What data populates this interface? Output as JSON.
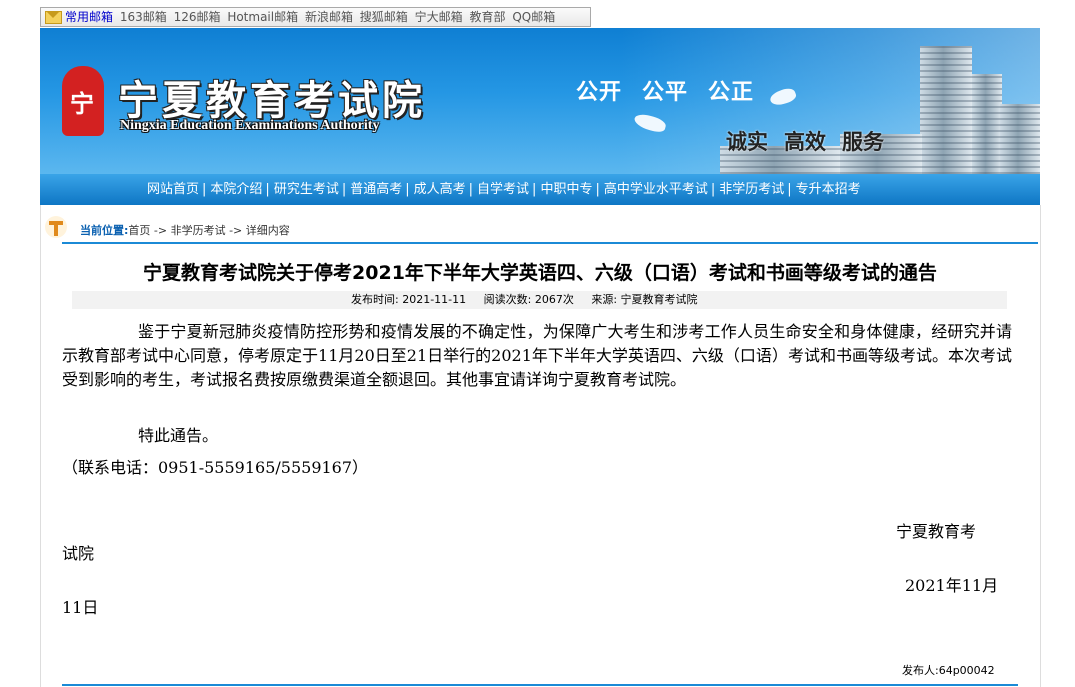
{
  "mailbar": {
    "items": [
      "常用邮箱",
      "163邮箱",
      "126邮箱",
      "Hotmail邮箱",
      "新浪邮箱",
      "搜狐邮箱",
      "宁大邮箱",
      "教育部",
      "QQ邮箱"
    ]
  },
  "header": {
    "logo_cn": "宁夏教育考试院",
    "logo_en": "Ningxia Education Examinations Authority",
    "slogan_top": [
      "公开",
      "公平",
      "公正"
    ],
    "slogan_bottom": [
      "诚实",
      "高效",
      "服务"
    ]
  },
  "nav": {
    "items": [
      "网站首页",
      "本院介绍",
      "研究生考试",
      "普通高考",
      "成人高考",
      "自学考试",
      "中职中专",
      "高中学业水平考试",
      "非学历考试",
      "专升本招考"
    ]
  },
  "breadcrumb": {
    "label": "当前位置:",
    "path": "首页 -> 非学历考试 -> 详细内容"
  },
  "article": {
    "title": "宁夏教育考试院关于停考2021年下半年大学英语四、六级（口语）考试和书画等级考试的通告",
    "meta": {
      "date": "发布时间:   2021-11-11",
      "views": "阅读次数: 2067次",
      "source": "来源: 宁夏教育考试院"
    },
    "paragraph1": "鉴于宁夏新冠肺炎疫情防控形势和疫情发展的不确定性，为保障广大考生和涉考工作人员生命安全和身体健康，经研究并请示教育部考试中心同意，停考原定于11月20日至21日举行的2021年下半年大学英语四、六级（口语）考试和书画等级考试。本次考试受到影响的考生，考试报名费按原缴费渠道全额退回。其他事宜请详询宁夏教育考试院。",
    "notice": "特此通告。",
    "contact": "（联系电话：0951-5559165/5559167）",
    "signature_a": "宁夏教育考",
    "signature_b": "试院",
    "date_a": "2021年11月",
    "date_b": "11日",
    "publisher": "发布人:64p00042"
  }
}
